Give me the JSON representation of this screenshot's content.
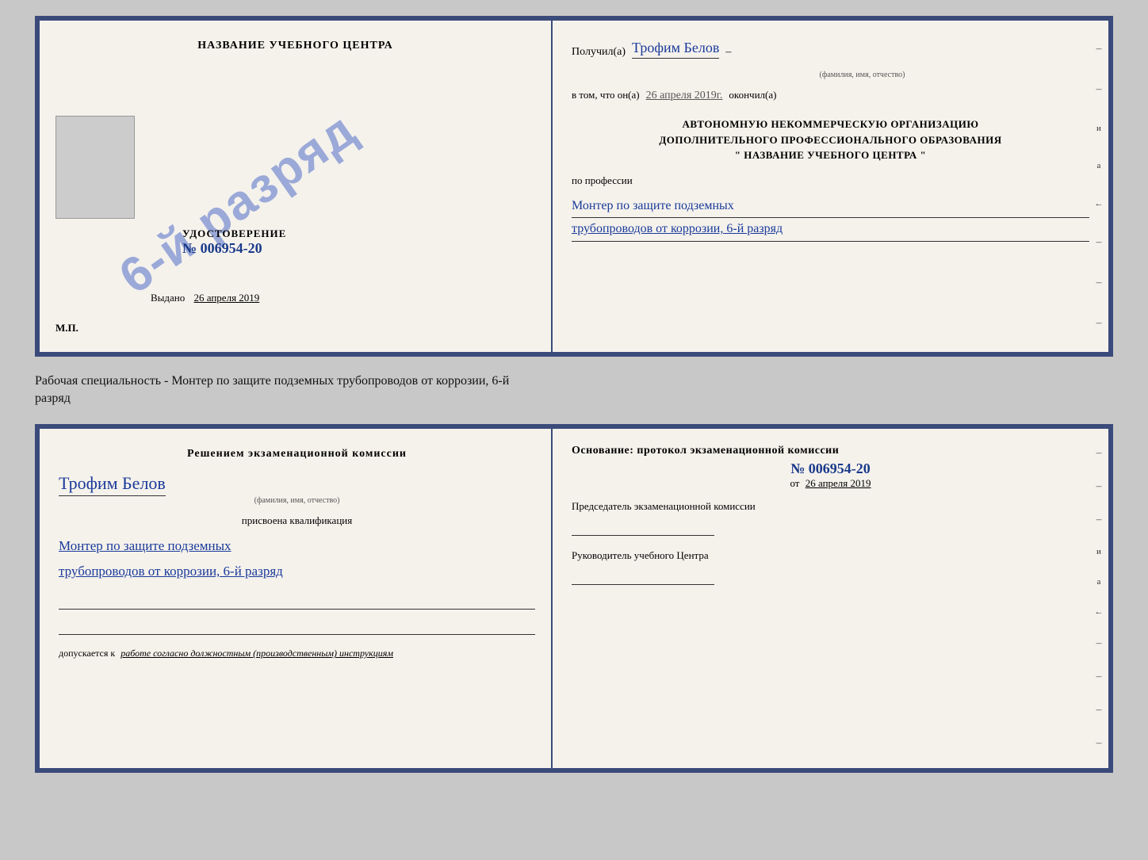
{
  "page": {
    "background": "#c8c8c8"
  },
  "cert_top": {
    "left": {
      "training_center_label": "НАЗВАНИЕ УЧЕБНОГО ЦЕНТРА",
      "stamp_text": "6-й разряд",
      "udostoverenie_label": "УДОСТОВЕРЕНИЕ",
      "udostoverenie_number": "№ 006954-20",
      "vydano_label": "Выдано",
      "vydano_date": "26 апреля 2019",
      "mp_label": "М.П."
    },
    "right": {
      "recipient_prefix": "Получил(а)",
      "recipient_name": "Трофим Белов",
      "recipient_sublabel": "(фамилия, имя, отчество)",
      "dash": "–",
      "date_prefix": "в том, что он(а)",
      "date_value": "26 апреля 2019г.",
      "date_suffix": "окончил(а)",
      "org_line1": "АВТОНОМНУЮ НЕКОММЕРЧЕСКУЮ ОРГАНИЗАЦИЮ",
      "org_line2": "ДОПОЛНИТЕЛЬНОГО ПРОФЕССИОНАЛЬНОГО ОБРАЗОВАНИЯ",
      "org_line3": "\" НАЗВАНИЕ УЧЕБНОГО ЦЕНТРА \"",
      "profession_prefix": "по профессии",
      "profession_line1": "Монтер по защите подземных",
      "profession_line2": "трубопроводов от коррозии, 6-й разряд",
      "right_marks": [
        "–",
        "–",
        "и",
        "а",
        "←",
        "–",
        "–",
        "–"
      ]
    }
  },
  "middle_text": {
    "line1": "Рабочая специальность - Монтер по защите подземных трубопроводов от коррозии, 6-й",
    "line2": "разряд"
  },
  "cert_bottom": {
    "left": {
      "decision_text": "Решением экзаменационной комиссии",
      "person_name": "Трофим Белов",
      "person_sublabel": "(фамилия, имя, отчество)",
      "assigned_text": "присвоена квалификация",
      "qualification_line1": "Монтер по защите подземных",
      "qualification_line2": "трубопроводов от коррозии, 6-й разряд",
      "blank_lines": 2,
      "dopuskaetsya_prefix": "допускается к",
      "dopuskaetsya_text": "работе согласно должностным (производственным) инструкциям"
    },
    "right": {
      "osnovaniye_text": "Основание: протокол экзаменационной комиссии",
      "protocol_number": "№ 006954-20",
      "ot_prefix": "от",
      "ot_date": "26 апреля 2019",
      "chairman_label": "Председатель экзаменационной комиссии",
      "director_label": "Руководитель учебного Центра",
      "right_marks": [
        "–",
        "–",
        "–",
        "и",
        "а",
        "←",
        "–",
        "–",
        "–",
        "–"
      ]
    }
  }
}
